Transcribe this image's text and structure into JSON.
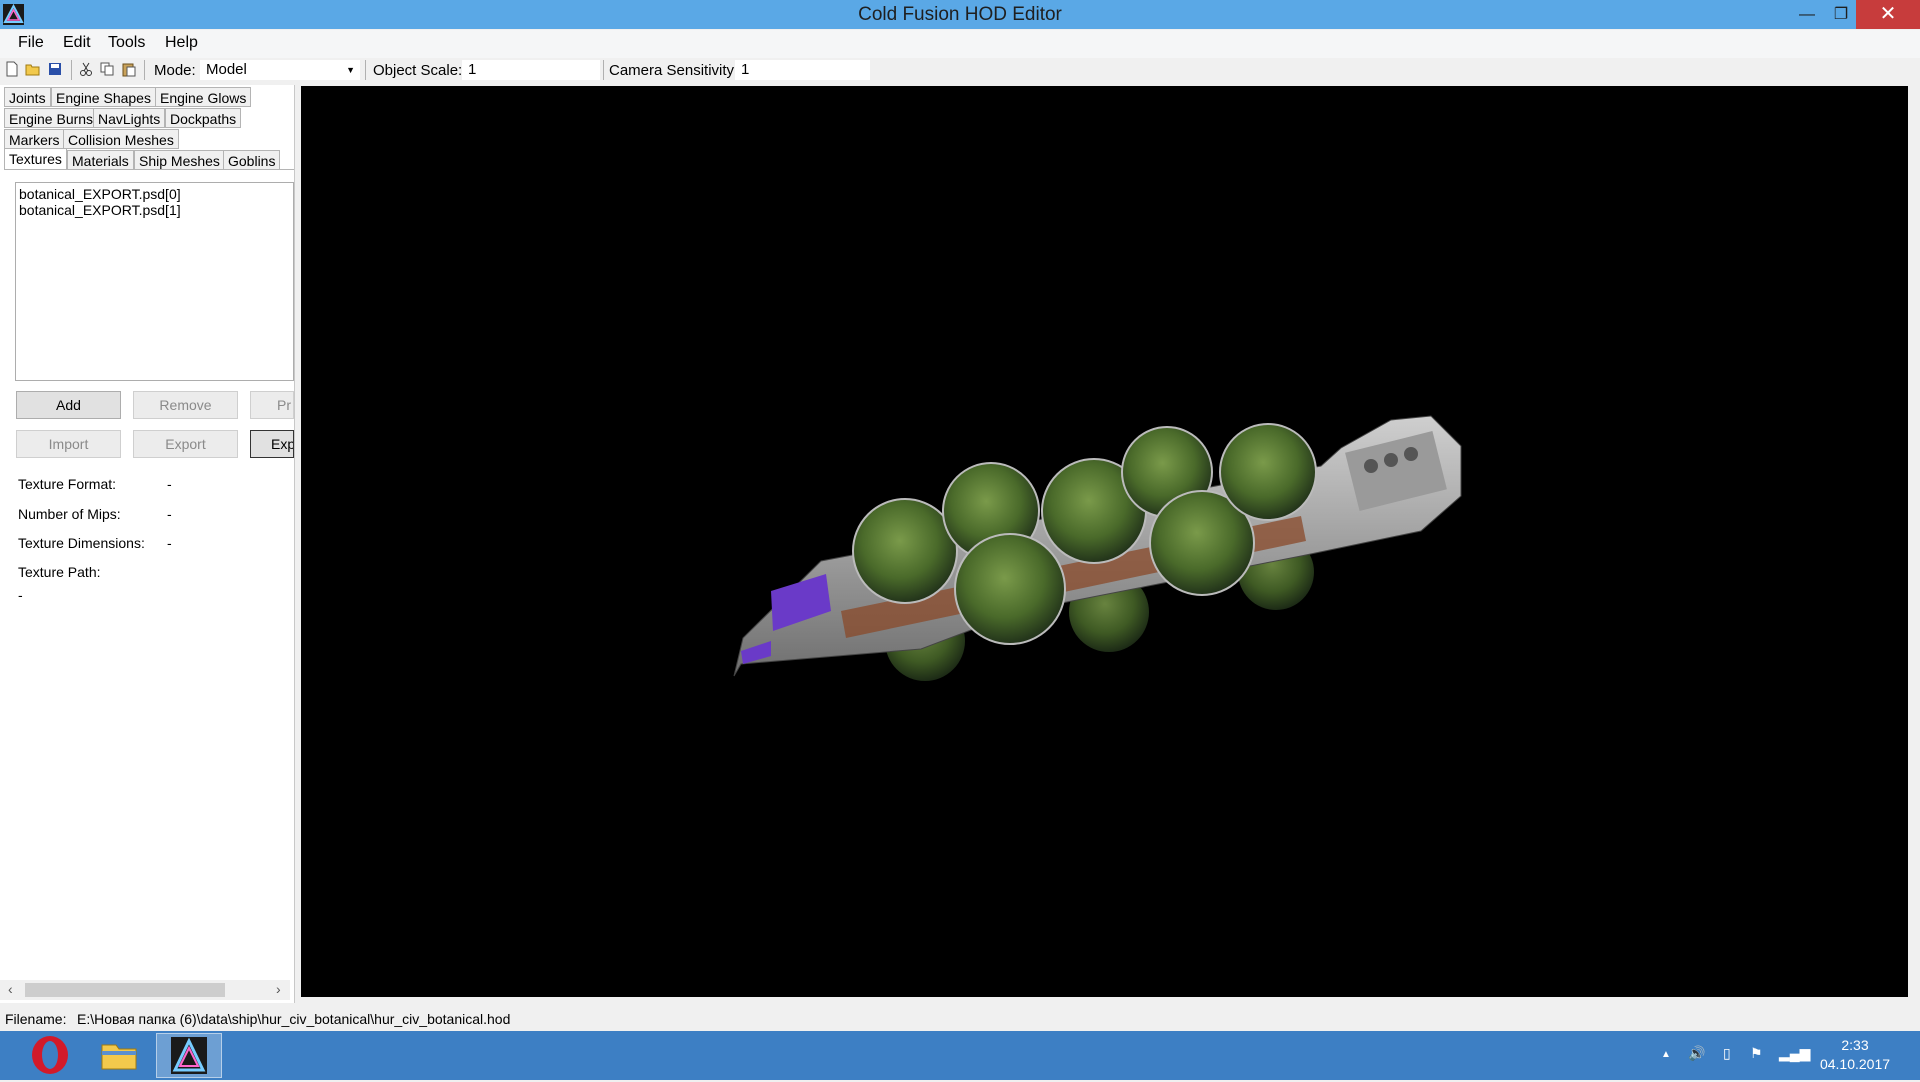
{
  "window": {
    "title": "Cold Fusion HOD Editor",
    "minimize_glyph": "—",
    "maximize_glyph": "❐",
    "close_glyph": "✕"
  },
  "menu": {
    "items": [
      "File",
      "Edit",
      "Tools",
      "Help"
    ]
  },
  "toolbar": {
    "icons": [
      "new-file-icon",
      "open-folder-icon",
      "save-icon",
      "cut-icon",
      "copy-icon",
      "paste-icon"
    ],
    "mode_label": "Mode:",
    "mode_value": "Model",
    "object_scale_label": "Object Scale:",
    "object_scale_value": "1",
    "camera_sensitivity_label": "Camera Sensitivity:",
    "camera_sensitivity_value": "1"
  },
  "tabs": {
    "row1": [
      "Joints",
      "Engine Shapes",
      "Engine Glows"
    ],
    "row2": [
      "Engine Burns",
      "NavLights",
      "Dockpaths"
    ],
    "row3": [
      "Markers",
      "Collision Meshes"
    ],
    "row4": [
      "Textures",
      "Materials",
      "Ship Meshes",
      "Goblins"
    ],
    "active": "Textures"
  },
  "textures": {
    "list": [
      "botanical_EXPORT.psd[0]",
      "botanical_EXPORT.psd[1]"
    ],
    "buttons": {
      "add": "Add",
      "remove": "Remove",
      "preview_partial": "Pr",
      "import": "Import",
      "export": "Export",
      "export_partial": "Exp"
    },
    "props": {
      "format_label": "Texture Format:",
      "format_value": "-",
      "mips_label": "Number of Mips:",
      "mips_value": "-",
      "dimensions_label": "Texture Dimensions:",
      "dimensions_value": "-",
      "path_label": "Texture Path:",
      "path_value": "-"
    }
  },
  "status": {
    "filename_label": "Filename:",
    "filename_value": "E:\\Новая папка (6)\\data\\ship\\hur_civ_botanical\\hur_civ_botanical.hod"
  },
  "taskbar": {
    "apps": [
      "opera-icon",
      "file-explorer-icon",
      "cold-fusion-icon"
    ],
    "clock_time": "2:33",
    "clock_date": "04.10.2017"
  },
  "colors": {
    "titlebar": "#5aa8e6",
    "taskbar": "#3d7fc4",
    "close": "#c73c3c",
    "viewport": "#000000"
  }
}
